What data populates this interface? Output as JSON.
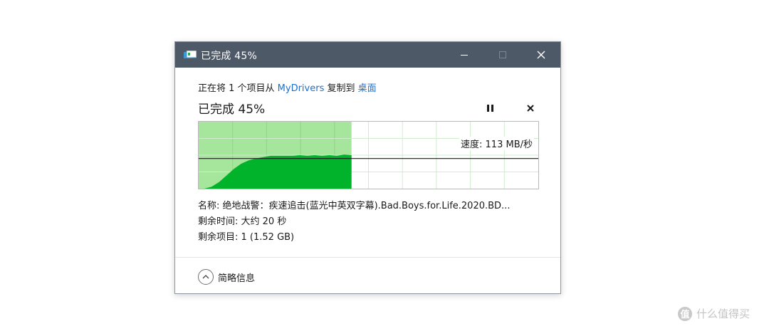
{
  "window": {
    "title": "已完成 45%",
    "colors": {
      "titlebar": "#4e5968",
      "link": "#1e6fc8",
      "graph_fill": "#00b32b",
      "graph_shade": "#a6e59c"
    }
  },
  "copy": {
    "prefix": "正在将 1 个项目从 ",
    "source": "MyDrivers",
    "middle": " 复制到 ",
    "destination": "桌面"
  },
  "progress": {
    "title": "已完成 45%",
    "percent": 45,
    "speed_label": "速度: 113 MB/秒",
    "speed_line_fraction": 0.45,
    "throughput_curve": [
      0.0,
      0.03,
      0.1,
      0.2,
      0.3,
      0.38,
      0.43,
      0.46,
      0.48,
      0.5,
      0.5,
      0.5,
      0.5,
      0.51,
      0.5,
      0.51,
      0.5,
      0.51,
      0.5,
      0.52,
      0.51
    ]
  },
  "details": {
    "name_label": "名称: ",
    "name_value": "绝地战警：疾速追击(蓝光中英双字幕).Bad.Boys.for.Life.2020.BD...",
    "time_label": "剩余时间: ",
    "time_value": "大约 20 秒",
    "items_label": "剩余项目: ",
    "items_value": "1 (1.52 GB)"
  },
  "footer": {
    "toggle_label": "简略信息"
  },
  "controls": {
    "pause_icon": "pause-icon",
    "cancel_glyph": "✕",
    "close_glyph": "✕"
  },
  "watermark": {
    "icon_text": "值",
    "text": "什么值得买"
  }
}
